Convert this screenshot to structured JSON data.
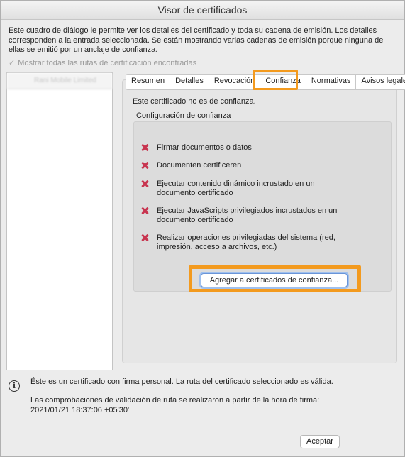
{
  "window": {
    "title": "Visor de certificados"
  },
  "description": "Este cuadro de diálogo le permite ver los detalles del certificado y toda su cadena de emisión. Los detalles corresponden a la entrada seleccionada. Se están mostrando varias cadenas de emisión porque ninguna de ellas se emitió por un anclaje de confianza.",
  "show_all_paths": {
    "label": "Mostrar todas las rutas de certificación encontradas",
    "checked": true
  },
  "cert_list": {
    "items": [
      {
        "label": "Rani Mobile Limited"
      }
    ]
  },
  "tabs": [
    {
      "label": "Resumen"
    },
    {
      "label": "Detalles"
    },
    {
      "label": "Revocación"
    },
    {
      "label": "Confianza"
    },
    {
      "label": "Normativas"
    },
    {
      "label": "Avisos legales"
    }
  ],
  "active_tab": "Confianza",
  "trust": {
    "status": "Este certificado no es de confianza.",
    "config_label": "Configuración de confianza",
    "permissions": [
      {
        "text": "Firmar documentos o datos",
        "icon": "x-icon"
      },
      {
        "text": "Documenten certificeren",
        "icon": "x-icon"
      },
      {
        "text": "Ejecutar contenido dinámico incrustado en un documento certificado",
        "icon": "x-icon"
      },
      {
        "text": "Ejecutar JavaScripts privilegiados incrustados en un documento certificado",
        "icon": "x-icon"
      },
      {
        "text": "Realizar operaciones privilegiadas del sistema (red, impresión, acceso a archivos, etc.)",
        "icon": "x-icon"
      }
    ],
    "add_button": "Agregar a certificados de confianza..."
  },
  "status": {
    "line1": "Éste es un certificado con firma personal. La ruta del certificado seleccionado es válida.",
    "line2": "Las comprobaciones de validación de ruta se realizaron a partir de la hora de firma:",
    "line3": "2021/01/21 18:37:06 +05'30'"
  },
  "ok_button": "Aceptar",
  "colors": {
    "highlight": "#f39a1e",
    "x_icon": "#c8344f",
    "focus_ring": "#6a95d8"
  }
}
